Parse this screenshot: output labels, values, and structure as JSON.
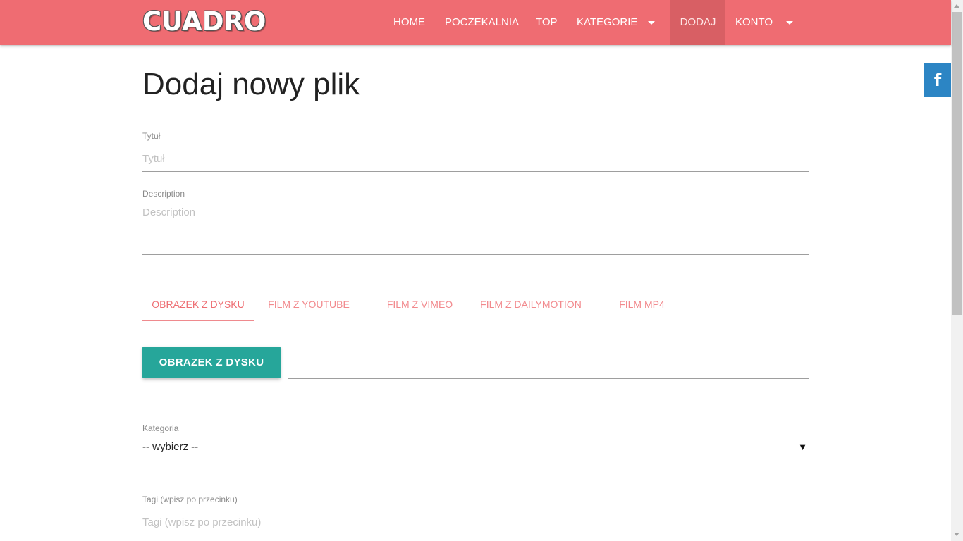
{
  "navbar": {
    "logo": "CUADRO",
    "items": [
      {
        "label": "HOME"
      },
      {
        "label": "POCZEKALNIA"
      },
      {
        "label": "TOP"
      },
      {
        "label": "KATEGORIE",
        "has_dropdown": true
      },
      {
        "label": "DODAJ",
        "active": true
      },
      {
        "label": "KONTO",
        "has_dropdown": true
      }
    ],
    "bg_color": "#ef6c72"
  },
  "social": {
    "facebook_icon": "facebook-icon",
    "glyph": "f"
  },
  "page": {
    "title": "Dodaj nowy plik"
  },
  "form": {
    "title_label": "Tytuł",
    "title_placeholder": "Tytuł",
    "description_label": "Description",
    "description_placeholder": "Description",
    "tabs": [
      {
        "label": "OBRAZEK Z DYSKU",
        "active": true
      },
      {
        "label": "FILM Z YOUTUBE"
      },
      {
        "label": "FILM Z VIMEO"
      },
      {
        "label": "FILM Z DAILYMOTION"
      },
      {
        "label": "FILM MP4"
      }
    ],
    "upload_button": "OBRAZEK Z DYSKU",
    "category_label": "Kategoria",
    "category_selected": "-- wybierz --",
    "tags_label": "Tagi (wpisz po przecinku)",
    "tags_placeholder": "Tagi (wpisz po przecinku)"
  },
  "colors": {
    "accent": "#ee6e73",
    "button": "#26a69a",
    "facebook": "#2c85c4"
  }
}
